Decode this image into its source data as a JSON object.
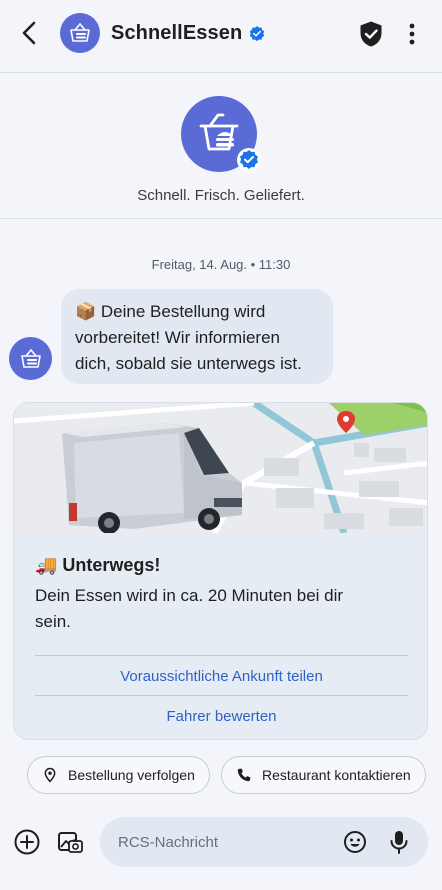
{
  "header": {
    "title": "SchnellEssen",
    "icons": {
      "back": "arrow-back-icon",
      "brand": "food-basket-icon",
      "verified": "verified-badge-icon",
      "security": "shield-check-icon",
      "more": "more-vert-icon"
    }
  },
  "profile": {
    "tagline": "Schnell. Frisch. Geliefert."
  },
  "conversation": {
    "timestamp": "Freitag, 14. Aug. • 11:30",
    "message": "📦 Deine Bestellung wird vorbereitet! Wir informieren dich, sobald sie unterwegs ist."
  },
  "card": {
    "title": "🚚 Unterwegs!",
    "body": "Dein Essen wird in ca. 20 Minuten bei dir sein.",
    "actions": [
      "Voraussichtliche Ankunft teilen",
      "Fahrer bewerten"
    ]
  },
  "suggestions": [
    {
      "label": "Bestellung verfolgen",
      "icon": "location-pin-icon"
    },
    {
      "label": "Restaurant kontaktieren",
      "icon": "phone-icon"
    }
  ],
  "composer": {
    "placeholder": "RCS-Nachricht",
    "icons": [
      "add-circle-icon",
      "gallery-icon",
      "emoji-icon",
      "mic-icon"
    ]
  },
  "colors": {
    "brand": "#5b6bd6",
    "verified": "#1a73e8",
    "link": "#2f62c9",
    "bubble": "#e1e8f2",
    "background": "#f3f5fa"
  }
}
